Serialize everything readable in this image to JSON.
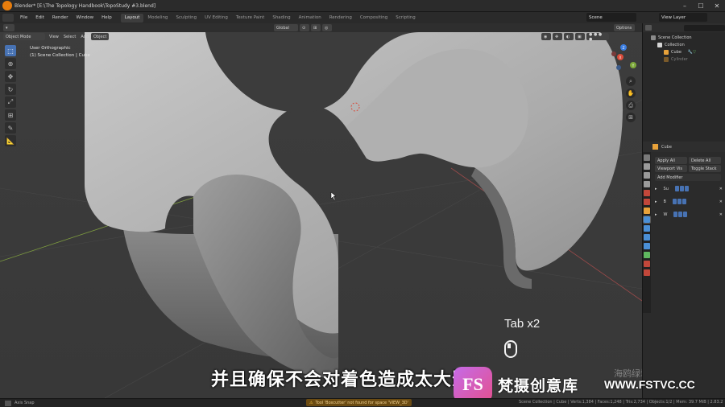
{
  "window": {
    "title": "Blender* [E:\\The Topology Handbook\\TopoStudy #3.blend]",
    "minimize": "–",
    "maximize": "☐",
    "close": "✕"
  },
  "menu": {
    "items": [
      "File",
      "Edit",
      "Render",
      "Window",
      "Help"
    ],
    "workspaces": [
      "Layout",
      "Modeling",
      "Sculpting",
      "UV Editing",
      "Texture Paint",
      "Shading",
      "Animation",
      "Rendering",
      "Compositing",
      "Scripting"
    ],
    "active_workspace": "Layout",
    "scene": "Scene",
    "view_layer": "View Layer"
  },
  "viewport_header": {
    "mode": "Object Mode",
    "menus": [
      "View",
      "Select",
      "Add",
      "Object"
    ],
    "transform": "Global",
    "options": "Options"
  },
  "viewport": {
    "view_name": "User Orthographic",
    "collection_path": "(1) Scene Collection | Cube",
    "gizmo_labels": [
      "X",
      "Y",
      "Z"
    ]
  },
  "overlay": {
    "tab_hint": "Tab x2",
    "subtitle": "并且确保不会对着色造成太大影响",
    "credit": "海鸥绿城字幕组译制"
  },
  "watermark": {
    "logo_text": "FS",
    "name": "梵摄创意库",
    "url": "WWW.FSTVC.CC"
  },
  "outliner": {
    "root": "Scene Collection",
    "items": [
      {
        "label": "Collection",
        "dim": false
      },
      {
        "label": "Cube",
        "dim": false
      },
      {
        "label": "Cylinder",
        "dim": true
      }
    ]
  },
  "properties": {
    "object_name": "Cube",
    "apply_all": "Apply All",
    "delete_all": "Delete All",
    "viewport_vis": "Viewport Vis",
    "toggle_stack": "Toggle Stack",
    "add_modifier": "Add Modifier",
    "modifiers": [
      "Su",
      "B",
      "W"
    ]
  },
  "statusbar": {
    "left": "Axis Snap",
    "warning": "Tool 'Boxcutter' not found for space 'VIEW_3D'",
    "stats": "Scene Collection | Cube | Verts:1,384 | Faces:1,248 | Tris:2,734 | Objects:1/2 | Mem: 39.7 MiB | 2.83.2"
  },
  "colors": {
    "accent": "#4772b3",
    "blender_orange": "#e87d0d",
    "warning_bg": "#6b4b12",
    "watermark_gradient_start": "#c56be8",
    "watermark_gradient_end": "#e4508f"
  }
}
